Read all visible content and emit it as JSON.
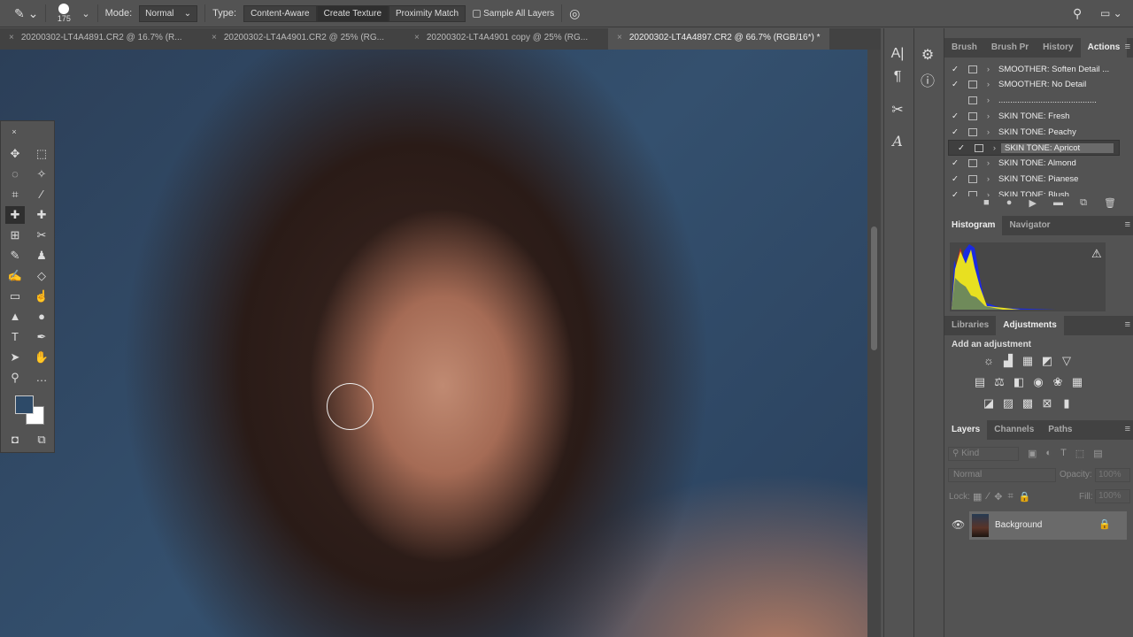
{
  "options_bar": {
    "brush_size": "175",
    "mode_label": "Mode:",
    "mode_value": "Normal",
    "type_label": "Type:",
    "type_options": [
      "Content-Aware",
      "Create Texture",
      "Proximity Match"
    ],
    "active_type": "Create Texture",
    "sample_all_layers": "Sample All Layers",
    "sample_all_checked": false
  },
  "doc_tabs": [
    "20200302-LT4A4891.CR2 @ 16.7% (R...",
    "20200302-LT4A4901.CR2 @ 25% (RG...",
    "20200302-LT4A4901 copy @ 25% (RG...",
    "20200302-LT4A4897.CR2 @ 66.7% (RGB/16*) *"
  ],
  "actions_panel": {
    "tabs": [
      "Brush",
      "Brush Pr",
      "History",
      "Actions"
    ],
    "active": "Actions",
    "items": [
      {
        "label": "SMOOTHER: Soften Detail ...",
        "checked": true
      },
      {
        "label": "SMOOTHER: No Detail",
        "checked": true
      },
      {
        "label": "..........................................",
        "checked": false
      },
      {
        "label": "SKIN TONE: Fresh",
        "checked": true
      },
      {
        "label": "SKIN TONE: Peachy",
        "checked": true
      },
      {
        "label": "SKIN TONE: Apricot",
        "checked": true,
        "selected": true
      },
      {
        "label": "SKIN TONE: Almond",
        "checked": true
      },
      {
        "label": "SKIN TONE: Pianese",
        "checked": true
      },
      {
        "label": "SKIN TONE: Blush",
        "checked": true
      }
    ]
  },
  "histogram_panel": {
    "tabs": [
      "Histogram",
      "Navigator"
    ]
  },
  "adjustments_panel": {
    "tabs": [
      "Libraries",
      "Adjustments"
    ],
    "heading": "Add an adjustment"
  },
  "layers_panel": {
    "tabs": [
      "Layers",
      "Channels",
      "Paths"
    ],
    "filter_placeholder": "Kind",
    "blend_mode": "Normal",
    "opacity_label": "Opacity:",
    "opacity": "100%",
    "lock_label": "Lock:",
    "fill_label": "Fill:",
    "fill": "100%",
    "layers": [
      {
        "name": "Background",
        "visible": true,
        "locked": true
      }
    ]
  }
}
